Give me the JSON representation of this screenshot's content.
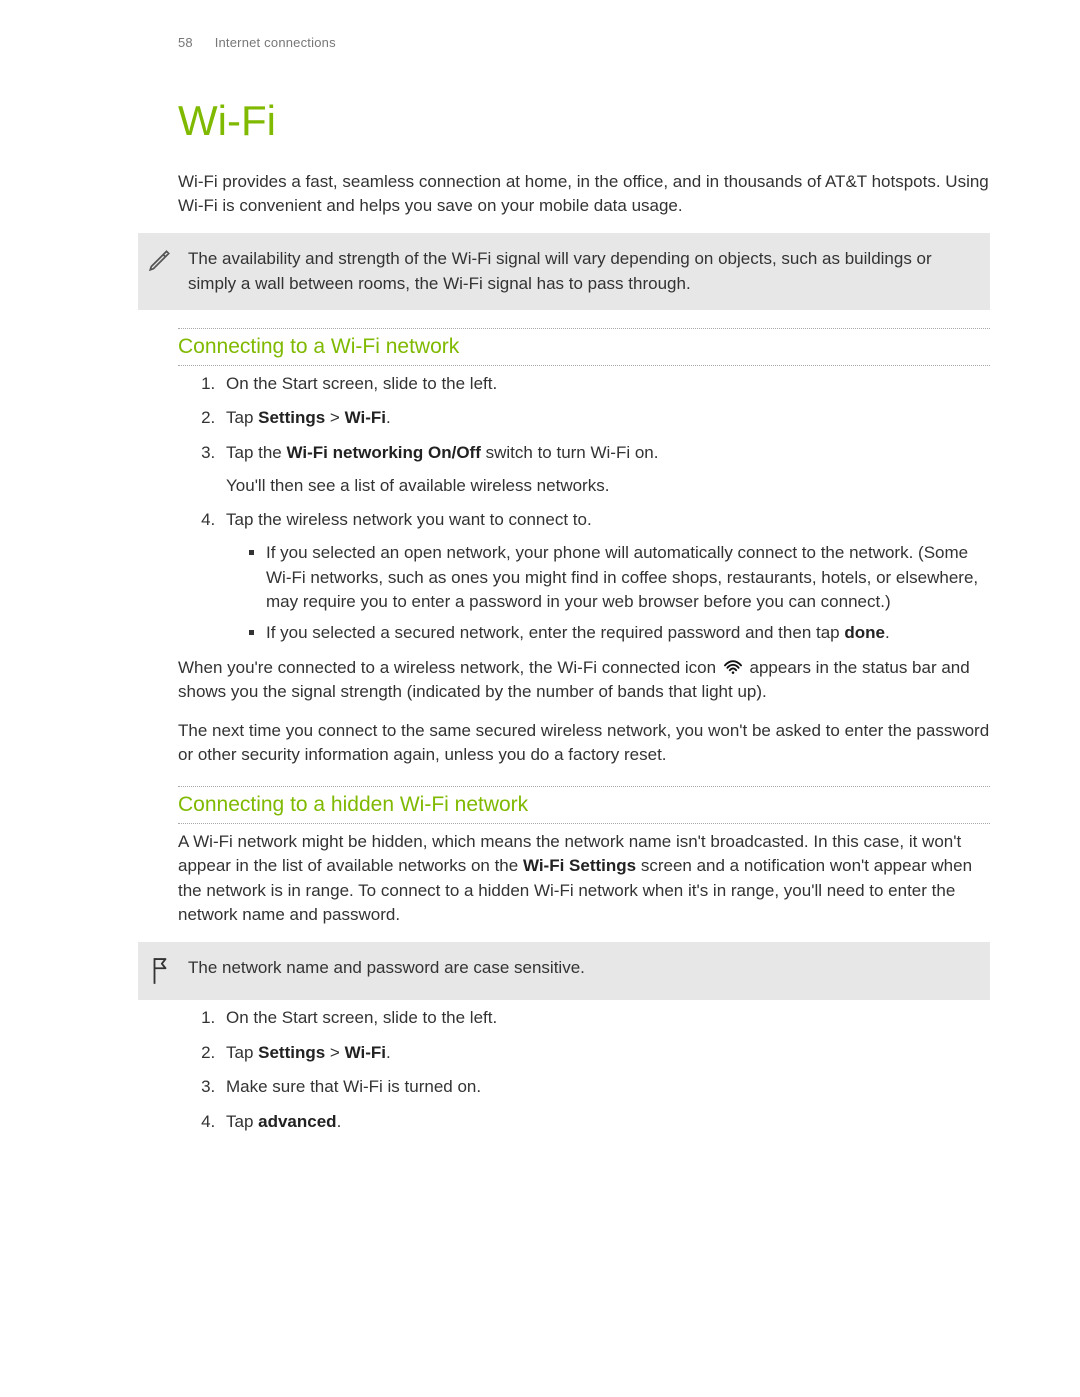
{
  "header": {
    "page_number": "58",
    "section": "Internet connections"
  },
  "title": "Wi-Fi",
  "intro": "Wi-Fi provides a fast, seamless connection at home, in the office, and in thousands of AT&T hotspots. Using Wi-Fi is convenient and helps you save on your mobile data usage.",
  "note1": "The availability and strength of the Wi-Fi signal will vary depending on objects, such as buildings or simply a wall between rooms, the Wi-Fi signal has to pass through.",
  "section1": {
    "heading": "Connecting to a Wi-Fi network",
    "step1": "On the Start screen, slide to the left.",
    "step2_pre": "Tap ",
    "step2_bold1": "Settings",
    "step2_mid": " > ",
    "step2_bold2": "Wi-Fi",
    "step2_post": ".",
    "step3_pre": "Tap the ",
    "step3_bold": "Wi-Fi networking On/Off",
    "step3_post": " switch to turn Wi-Fi on.",
    "step3_note": "You'll then see a list of available wireless networks.",
    "step4": "Tap the wireless network you want to connect to.",
    "bullet1": "If you selected an open network, your phone will automatically connect to the network. (Some Wi-Fi networks, such as ones you might find in coffee shops, restaurants, hotels, or elsewhere, may require you to enter a password in your web browser before you can connect.)",
    "bullet2_pre": "If you selected a secured network, enter the required password and then tap ",
    "bullet2_bold": "done",
    "bullet2_post": ".",
    "after1_pre": "When you're connected to a wireless network, the Wi-Fi connected icon ",
    "after1_post": " appears in the status bar and shows you the signal strength (indicated by the number of bands that light up).",
    "after2": "The next time you connect to the same secured wireless network, you won't be asked to enter the password or other security information again, unless you do a factory reset."
  },
  "section2": {
    "heading": "Connecting to a hidden Wi-Fi network",
    "intro_pre": "A Wi-Fi network might be hidden, which means the network name isn't broadcasted. In this case, it won't appear in the list of available networks on the ",
    "intro_bold": "Wi-Fi Settings",
    "intro_post": " screen and a notification won't appear when the network is in range. To connect to a hidden Wi-Fi network when it's in range, you'll need to enter the network name and password.",
    "note": "The network name and password are case sensitive.",
    "step1": "On the Start screen, slide to the left.",
    "step2_pre": "Tap ",
    "step2_bold1": "Settings",
    "step2_mid": " > ",
    "step2_bold2": "Wi-Fi",
    "step2_post": ".",
    "step3": "Make sure that Wi-Fi is turned on.",
    "step4_pre": "Tap ",
    "step4_bold": "advanced",
    "step4_post": "."
  }
}
